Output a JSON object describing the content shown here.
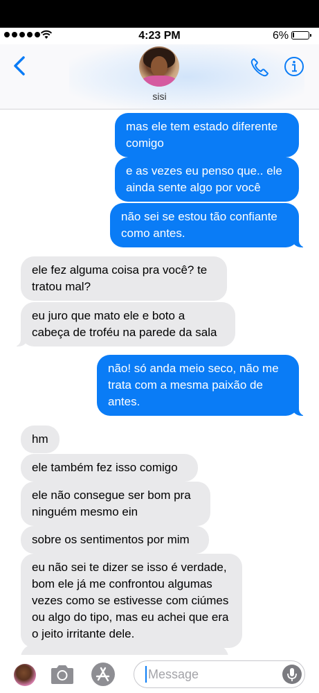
{
  "status_bar": {
    "time": "4:23 PM",
    "battery_percent": "6%",
    "battery_level": 0.06,
    "signal_bars": 5
  },
  "header": {
    "contact_name": "sisi",
    "back_icon": "chevron-left-icon",
    "phone_icon": "phone-icon",
    "info_icon": "info-icon"
  },
  "messages": [
    {
      "direction": "outgoing",
      "text": "mas ele tem estado diferente comigo"
    },
    {
      "direction": "outgoing",
      "text": "e as vezes eu penso que.. ele ainda sente algo por você"
    },
    {
      "direction": "outgoing",
      "text": "não sei se estou tão confiante como antes."
    },
    {
      "direction": "incoming",
      "text": "ele fez alguma coisa pra você? te tratou mal?"
    },
    {
      "direction": "incoming",
      "text": "eu juro que mato ele e boto a cabeça de troféu na parede da sala"
    },
    {
      "direction": "outgoing",
      "text": "não! só anda meio seco, não me trata com a mesma paixão de antes."
    },
    {
      "direction": "incoming",
      "text": "hm"
    },
    {
      "direction": "incoming",
      "text": "ele também fez isso comigo"
    },
    {
      "direction": "incoming",
      "text": "ele não consegue ser bom pra ninguém mesmo ein"
    },
    {
      "direction": "incoming",
      "text": "sobre os sentimentos por mim"
    },
    {
      "direction": "incoming",
      "text": "eu não sei te dizer se isso é verdade, bom ele já me confrontou algumas vezes como se estivesse com ciúmes ou algo do tipo, mas eu achei que era o jeito irritante dele."
    },
    {
      "direction": "incoming",
      "text": ""
    }
  ],
  "composer": {
    "placeholder": "Message",
    "camera_icon": "camera-icon",
    "apps_icon": "app-store-icon",
    "mic_icon": "microphone-icon"
  },
  "colors": {
    "outgoing_bubble": "#0a7cf6",
    "incoming_bubble": "#e9e9eb",
    "accent": "#0a7cf6"
  }
}
